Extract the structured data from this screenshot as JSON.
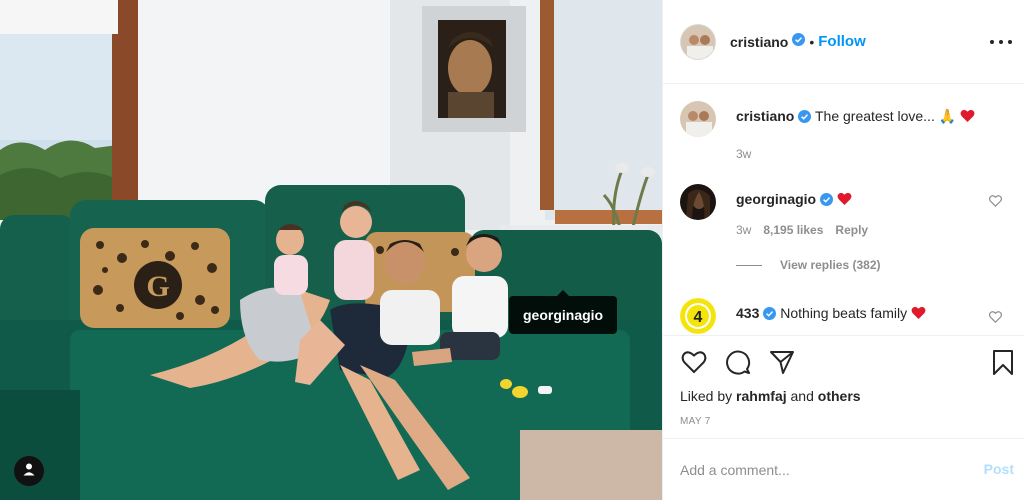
{
  "photo": {
    "tag_label": "georginagio",
    "tag_user_icon": "user-icon",
    "pillow_letter": "G"
  },
  "header": {
    "username": "cristiano",
    "separator": "•",
    "follow_label": "Follow",
    "more_icon": "more-horizontal-icon"
  },
  "caption": {
    "username": "cristiano",
    "text": "The greatest love... 🙏",
    "time": "3w"
  },
  "comments": [
    {
      "username": "georginagio",
      "text": "",
      "time": "3w",
      "likes": "8,195 likes",
      "reply_label": "Reply",
      "view_replies": "View replies (382)"
    },
    {
      "username": "433",
      "avatar_text": "4",
      "text": "Nothing beats family"
    }
  ],
  "actions": {
    "like_icon": "heart-icon",
    "comment_icon": "comment-icon",
    "share_icon": "share-icon",
    "save_icon": "bookmark-icon",
    "liked_by_prefix": "Liked by",
    "liked_by_user": "rahmfaj",
    "liked_by_and": "and",
    "liked_by_others": "others",
    "date": "MAY 7"
  },
  "add_comment": {
    "placeholder": "Add a comment...",
    "post_label": "Post"
  },
  "colors": {
    "accent": "#0095f6",
    "verified": "#3897f0",
    "heart": "#ed4956",
    "sofa": "#0f5a48",
    "post_disabled": "#b2dffc"
  }
}
